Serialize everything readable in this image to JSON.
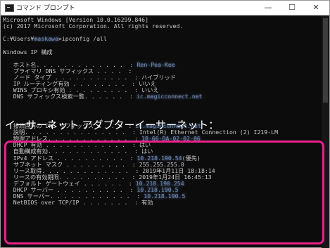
{
  "window": {
    "title": "コマンド プロンプト",
    "min_glyph": "—",
    "max_glyph": "☐",
    "close_glyph": "✕"
  },
  "console": {
    "lines": [
      "Microsoft Windows [Version 10.0.16299.846]",
      "(c) 2017 Microsoft Corporation. All rights reserved.",
      "",
      "C:¥Users¥",
      "",
      "Windows IP 構成",
      ""
    ],
    "user_blurred": "maskawa",
    "command": ">ipconfig /all",
    "ip_config": [
      {
        "label": "   ホスト名. . . . . . . . . . . . .  : ",
        "value": "Ren-Pea-Kee",
        "blurred": true
      },
      {
        "label": "   プライマリ DNS サフィックス . . . .  : ",
        "value": "",
        "blurred": false
      },
      {
        "label": "   ノード タイプ . . . . . . . . . . .  : ",
        "value": "ハイブリッド",
        "blurred": false
      },
      {
        "label": "   IP ルーティング有効 . . . . . . . .  : ",
        "value": "いいえ",
        "blurred": false
      },
      {
        "label": "   WINS プロキシ有効 . . . . . . . . .  : ",
        "value": "いいえ",
        "blurred": false
      },
      {
        "label": "   DNS サフィックス検索一覧. . . . . .  : ",
        "value": "ic.magicconnect.net",
        "blurred": true
      }
    ],
    "adapter_heading": "イーサーネット アダプターイーサーネット：",
    "adapter": [
      {
        "label": "   接続固有の DNS サフィックス . . . .  : ",
        "value": "ic.magicconnect.net",
        "blurred": true
      },
      {
        "label": "   説明. . . . . . . . . . . . . . .  : ",
        "value": "Intel(R) Ethernet Connection (2) I219-LM",
        "blurred": false
      },
      {
        "label": "   物理アドレス. . . . . . . . . . . .  : ",
        "value": "18-66-DA-02-02-06",
        "blurred": true
      },
      {
        "label": "   DHCP 有効 . . . . . . . . . . . .  : ",
        "value": "はい",
        "blurred": false
      },
      {
        "label": "   自動構成有効. . . . . . . . . . . .  : ",
        "value": "はい",
        "blurred": false
      },
      {
        "label": "   IPv4 アドレス . . . . . . . . . .  : ",
        "value": "10.218.190.54",
        "blurred": true,
        "suffix": "(優先)"
      },
      {
        "label": "   サブネット マスク . . . . . . . . .  : ",
        "value": "255.255.255.0",
        "blurred": false
      },
      {
        "label": "   リース取得. . . . . . . . . . . . .  : ",
        "value": "2019年1月11日 18:18:14",
        "blurred": false
      },
      {
        "label": "   リースの有効期限. . . . . . . . . .  : ",
        "value": "2019年1月24日 16:45:13",
        "blurred": false
      },
      {
        "label": "   デフォルト ゲートウェイ . . . . . .  : ",
        "value": "10.218.190.254",
        "blurred": true
      },
      {
        "label": "   DHCP サーバー . . . . . . . . . .  : ",
        "value": "10.218.190.5",
        "blurred": true
      },
      {
        "label": "   DNS サーバー. . . . . . . . . . . .  : ",
        "value": "10.218.190.5",
        "blurred": true
      },
      {
        "label": "   NetBIOS over TCP/IP . . . . . . .  : ",
        "value": "有効",
        "blurred": false
      }
    ]
  },
  "colors": {
    "console_bg": "#0c0c0c",
    "console_text": "#c8c8c8",
    "highlight": "#e8218a"
  }
}
